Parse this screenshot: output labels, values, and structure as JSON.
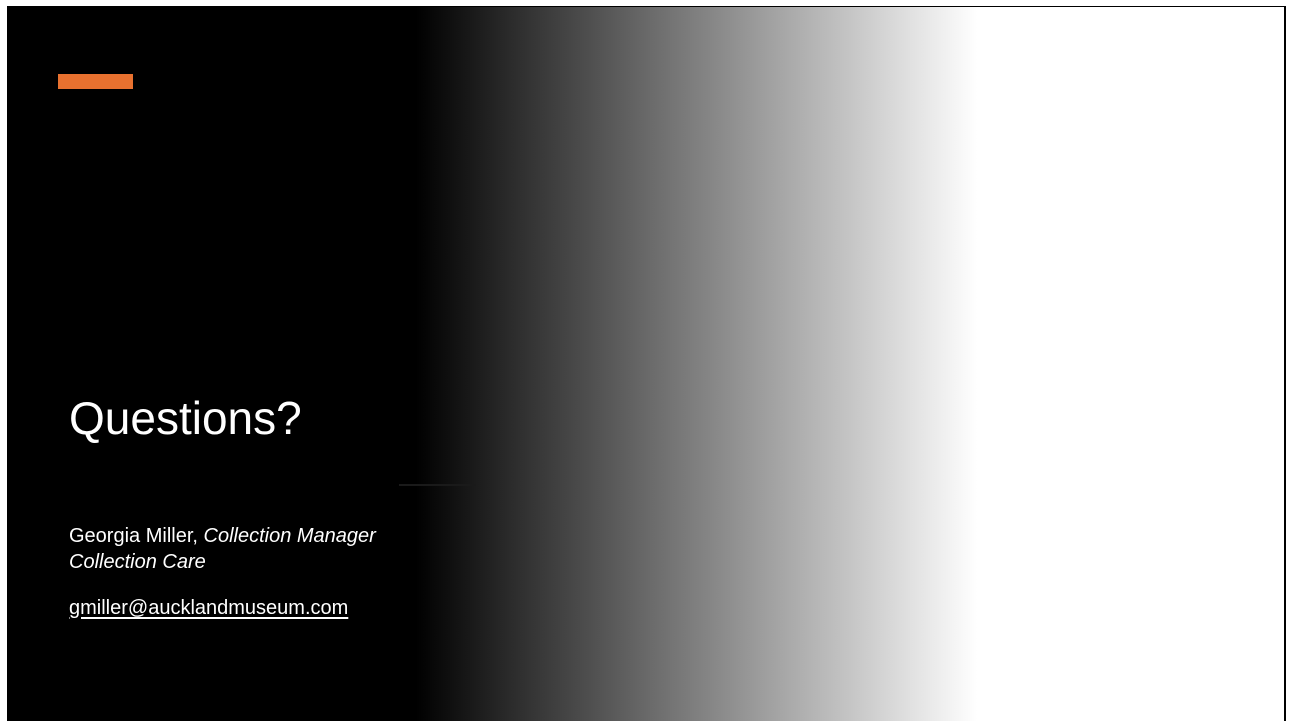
{
  "slide": {
    "title": "Questions?",
    "presenter": {
      "name": "Georgia Miller,",
      "role": "Collection Manager",
      "department": "Collection Care"
    },
    "email": "gmiller@aucklandmuseum.com"
  },
  "colors": {
    "accent": "#e8712f",
    "background_start": "#000000",
    "background_end": "#ffffff",
    "text": "#ffffff"
  }
}
